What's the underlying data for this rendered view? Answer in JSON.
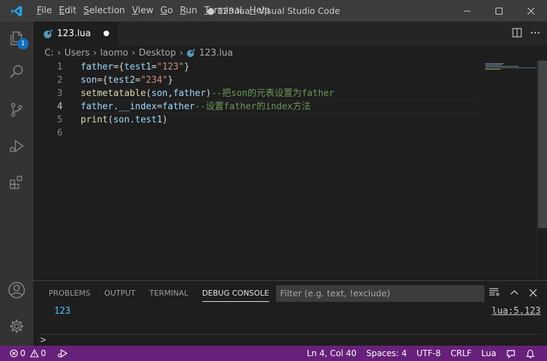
{
  "title_bar": {
    "window_title": "● 123.lua - Visual Studio Code",
    "menu": [
      {
        "first": "F",
        "rest": "ile"
      },
      {
        "first": "E",
        "rest": "dit"
      },
      {
        "first": "S",
        "rest": "election"
      },
      {
        "first": "V",
        "rest": "iew"
      },
      {
        "first": "G",
        "rest": "o"
      },
      {
        "first": "R",
        "rest": "un"
      },
      {
        "first": "T",
        "rest": "erminal"
      },
      {
        "first": "H",
        "rest": "elp"
      }
    ]
  },
  "activity_bar": {
    "explorer_badge": "1",
    "icons": [
      "explorer-icon",
      "search-icon",
      "source-control-icon",
      "run-debug-icon",
      "extensions-icon",
      "account-icon",
      "settings-gear-icon"
    ]
  },
  "tab": {
    "label": "123.lua",
    "dirty": true
  },
  "breadcrumb": [
    "C:",
    "Users",
    "laomo",
    "Desktop",
    "123.lua"
  ],
  "editor": {
    "active_line": 4,
    "line_numbers": [
      "1",
      "2",
      "3",
      "4",
      "5",
      "6"
    ],
    "lines": [
      [
        {
          "t": "father",
          "c": "t-var"
        },
        {
          "t": "={",
          "c": "t-pun"
        },
        {
          "t": "test1",
          "c": "t-var"
        },
        {
          "t": "=",
          "c": "t-pun"
        },
        {
          "t": "\"123\"",
          "c": "t-str"
        },
        {
          "t": "}",
          "c": "t-pun"
        }
      ],
      [
        {
          "t": "son",
          "c": "t-var"
        },
        {
          "t": "={",
          "c": "t-pun"
        },
        {
          "t": "test2",
          "c": "t-var"
        },
        {
          "t": "=",
          "c": "t-pun"
        },
        {
          "t": "\"234\"",
          "c": "t-str"
        },
        {
          "t": "}",
          "c": "t-pun"
        }
      ],
      [
        {
          "t": "setmetatable",
          "c": "t-fn"
        },
        {
          "t": "(",
          "c": "t-pun"
        },
        {
          "t": "son",
          "c": "t-var"
        },
        {
          "t": ",",
          "c": "t-pun"
        },
        {
          "t": "father",
          "c": "t-var"
        },
        {
          "t": ")",
          "c": "t-pun"
        },
        {
          "t": "--把son的元表设置为father",
          "c": "t-cmt"
        }
      ],
      [
        {
          "t": "father",
          "c": "t-var"
        },
        {
          "t": ".",
          "c": "t-pun"
        },
        {
          "t": "__index",
          "c": "t-var"
        },
        {
          "t": "=",
          "c": "t-pun"
        },
        {
          "t": "father",
          "c": "t-var"
        },
        {
          "t": "--设置father的index方法",
          "c": "t-cmt"
        }
      ],
      [
        {
          "t": "print",
          "c": "t-fn"
        },
        {
          "t": "(",
          "c": "t-pun"
        },
        {
          "t": "son",
          "c": "t-var"
        },
        {
          "t": ".",
          "c": "t-pun"
        },
        {
          "t": "test1",
          "c": "t-var"
        },
        {
          "t": ")",
          "c": "t-pun"
        }
      ],
      []
    ]
  },
  "panel": {
    "tabs": [
      "PROBLEMS",
      "OUTPUT",
      "TERMINAL",
      "DEBUG CONSOLE"
    ],
    "active_tab": "DEBUG CONSOLE",
    "filter_placeholder": "Filter (e.g. text, !exclude)",
    "console_output": "123",
    "console_source": "lua:5.123",
    "prompt": ">"
  },
  "status_bar": {
    "errors": "0",
    "warnings": "0",
    "cursor": "Ln 4, Col 40",
    "spaces": "Spaces: 4",
    "encoding": "UTF-8",
    "eol": "CRLF",
    "language": "Lua"
  },
  "colors": {
    "status_bar": "#68217a",
    "title_bar": "#3c3c3c",
    "activity_bar": "#333333",
    "editor_bg": "#1e1e1e",
    "badge": "#0e70c0",
    "lua_icon": "#519aba"
  }
}
